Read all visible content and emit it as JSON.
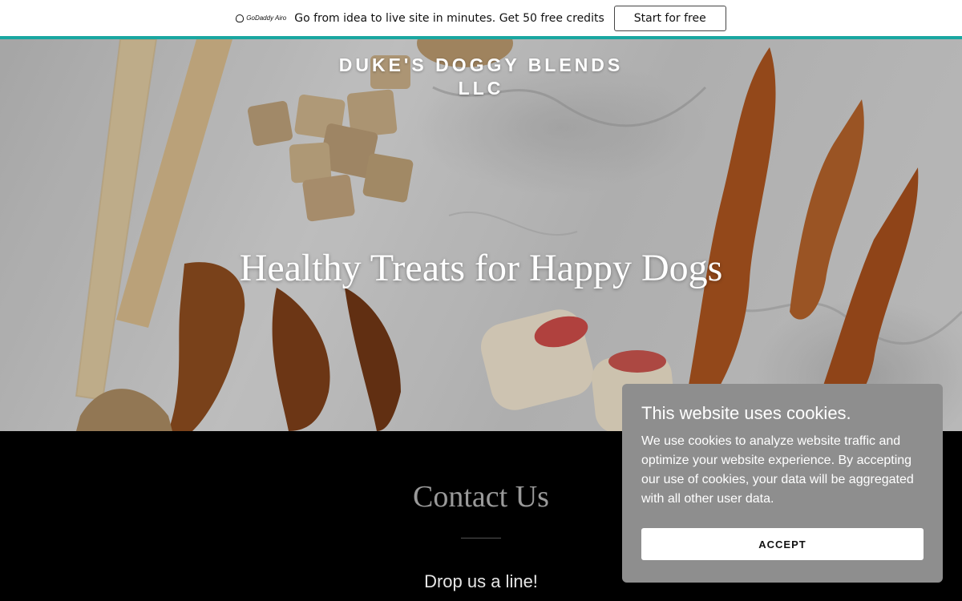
{
  "promo": {
    "logo_text": "GoDaddy Airo",
    "message": "Go from idea to live site in minutes. Get 50 free credits",
    "cta_label": "Start for free",
    "accent_color": "#1aa7a1"
  },
  "hero": {
    "brand_name": "DUKE'S DOGGY BLENDS LLC",
    "headline": "Healthy Treats for Happy Dogs"
  },
  "contact": {
    "title": "Contact Us",
    "subtitle": "Drop us a line!"
  },
  "cookie_banner": {
    "title": "This website uses cookies.",
    "body": "We use cookies to analyze website traffic and optimize your website experience. By accepting our use of cookies, your data will be aggregated with all other user data.",
    "accept_label": "ACCEPT"
  }
}
